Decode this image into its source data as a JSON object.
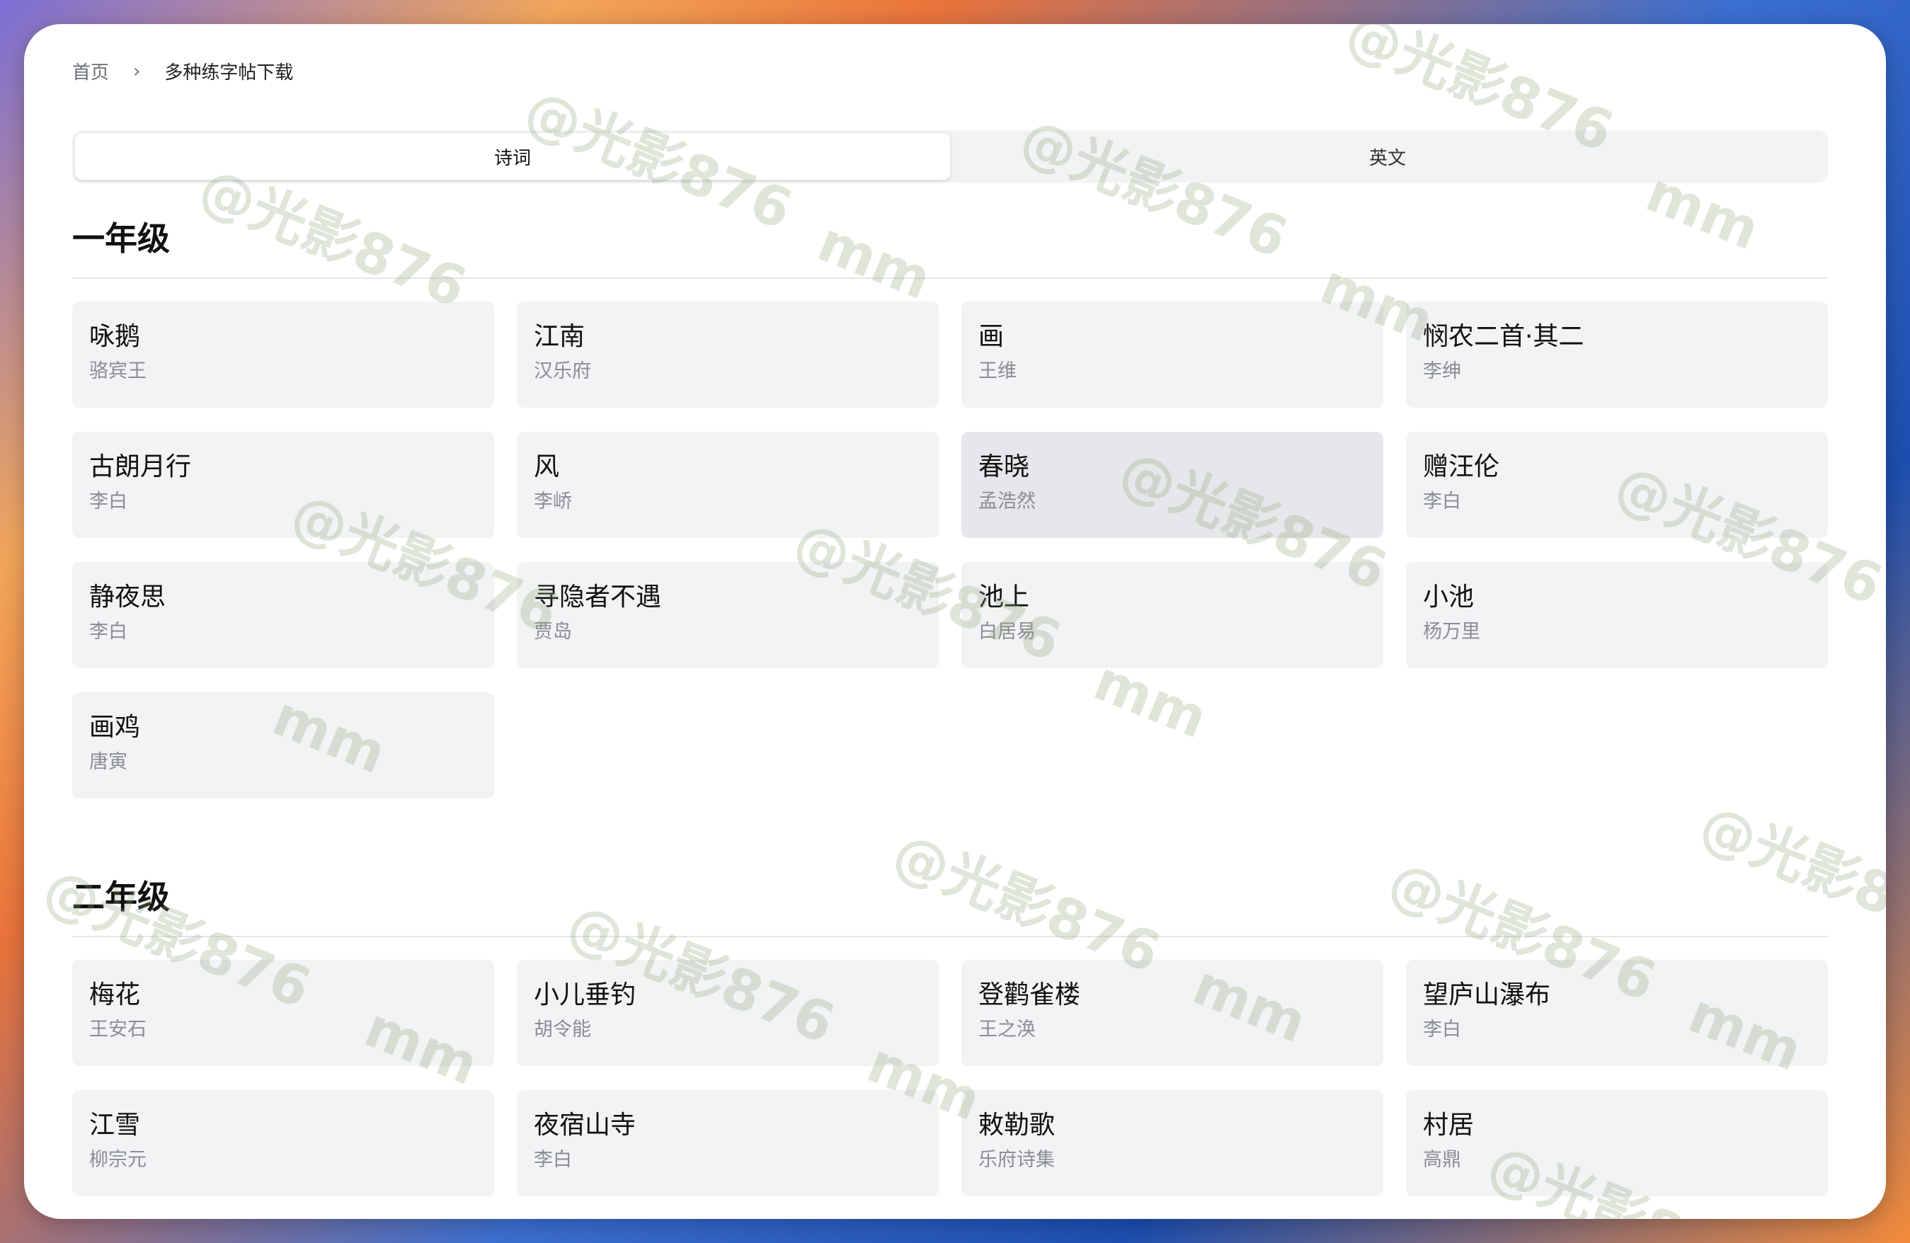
{
  "breadcrumb": {
    "home": "首页",
    "separator": "›",
    "current": "多种练字帖下载"
  },
  "tabs": [
    {
      "label": "诗词",
      "active": true
    },
    {
      "label": "英文",
      "active": false
    }
  ],
  "sections": [
    {
      "title": "一年级",
      "poems": [
        {
          "title": "咏鹅",
          "author": "骆宾王"
        },
        {
          "title": "江南",
          "author": "汉乐府"
        },
        {
          "title": "画",
          "author": "王维"
        },
        {
          "title": "悯农二首·其二",
          "author": "李绅"
        },
        {
          "title": "古朗月行",
          "author": "李白"
        },
        {
          "title": "风",
          "author": "李峤"
        },
        {
          "title": "春晓",
          "author": "孟浩然"
        },
        {
          "title": "赠汪伦",
          "author": "李白"
        },
        {
          "title": "静夜思",
          "author": "李白"
        },
        {
          "title": "寻隐者不遇",
          "author": "贾岛"
        },
        {
          "title": "池上",
          "author": "白居易"
        },
        {
          "title": "小池",
          "author": "杨万里"
        },
        {
          "title": "画鸡",
          "author": "唐寅"
        }
      ]
    },
    {
      "title": "二年级",
      "poems": [
        {
          "title": "梅花",
          "author": "王安石"
        },
        {
          "title": "小儿垂钓",
          "author": "胡令能"
        },
        {
          "title": "登鹳雀楼",
          "author": "王之涣"
        },
        {
          "title": "望庐山瀑布",
          "author": "李白"
        },
        {
          "title": "江雪",
          "author": "柳宗元"
        },
        {
          "title": "夜宿山寺",
          "author": "李白"
        },
        {
          "title": "敕勒歌",
          "author": "乐府诗集"
        },
        {
          "title": "村居",
          "author": "高鼎"
        }
      ]
    }
  ],
  "watermark": {
    "text": "@光影876",
    "text2": "mm"
  }
}
